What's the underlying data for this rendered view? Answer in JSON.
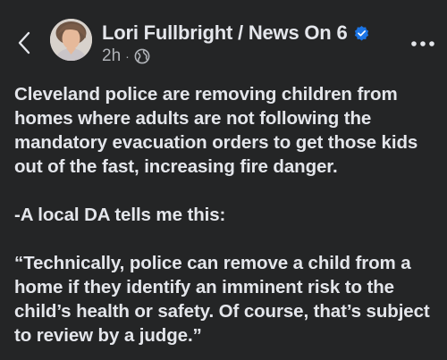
{
  "header": {
    "author_name": "Lori Fullbright / News On 6",
    "timestamp": "2h",
    "privacy_icon": "globe-icon",
    "back_icon": "chevron-left-icon",
    "more_icon": "more-horizontal-icon",
    "verified_icon": "verified-badge-icon"
  },
  "post": {
    "paragraphs": [
      "Cleveland police are removing children from homes where adults are not following the mandatory evacuation orders to get those kids out of the fast, increasing fire danger.",
      "-A local DA tells me this:",
      "“Technically, police can remove a child from a home if they identify an imminent risk to the child’s health or safety. Of course, that’s subject to review by a judge.”"
    ]
  },
  "colors": {
    "background": "#242526",
    "primary_text": "#e4e6eb",
    "secondary_text": "#b0b3b8",
    "verified_blue": "#1b74e4"
  }
}
